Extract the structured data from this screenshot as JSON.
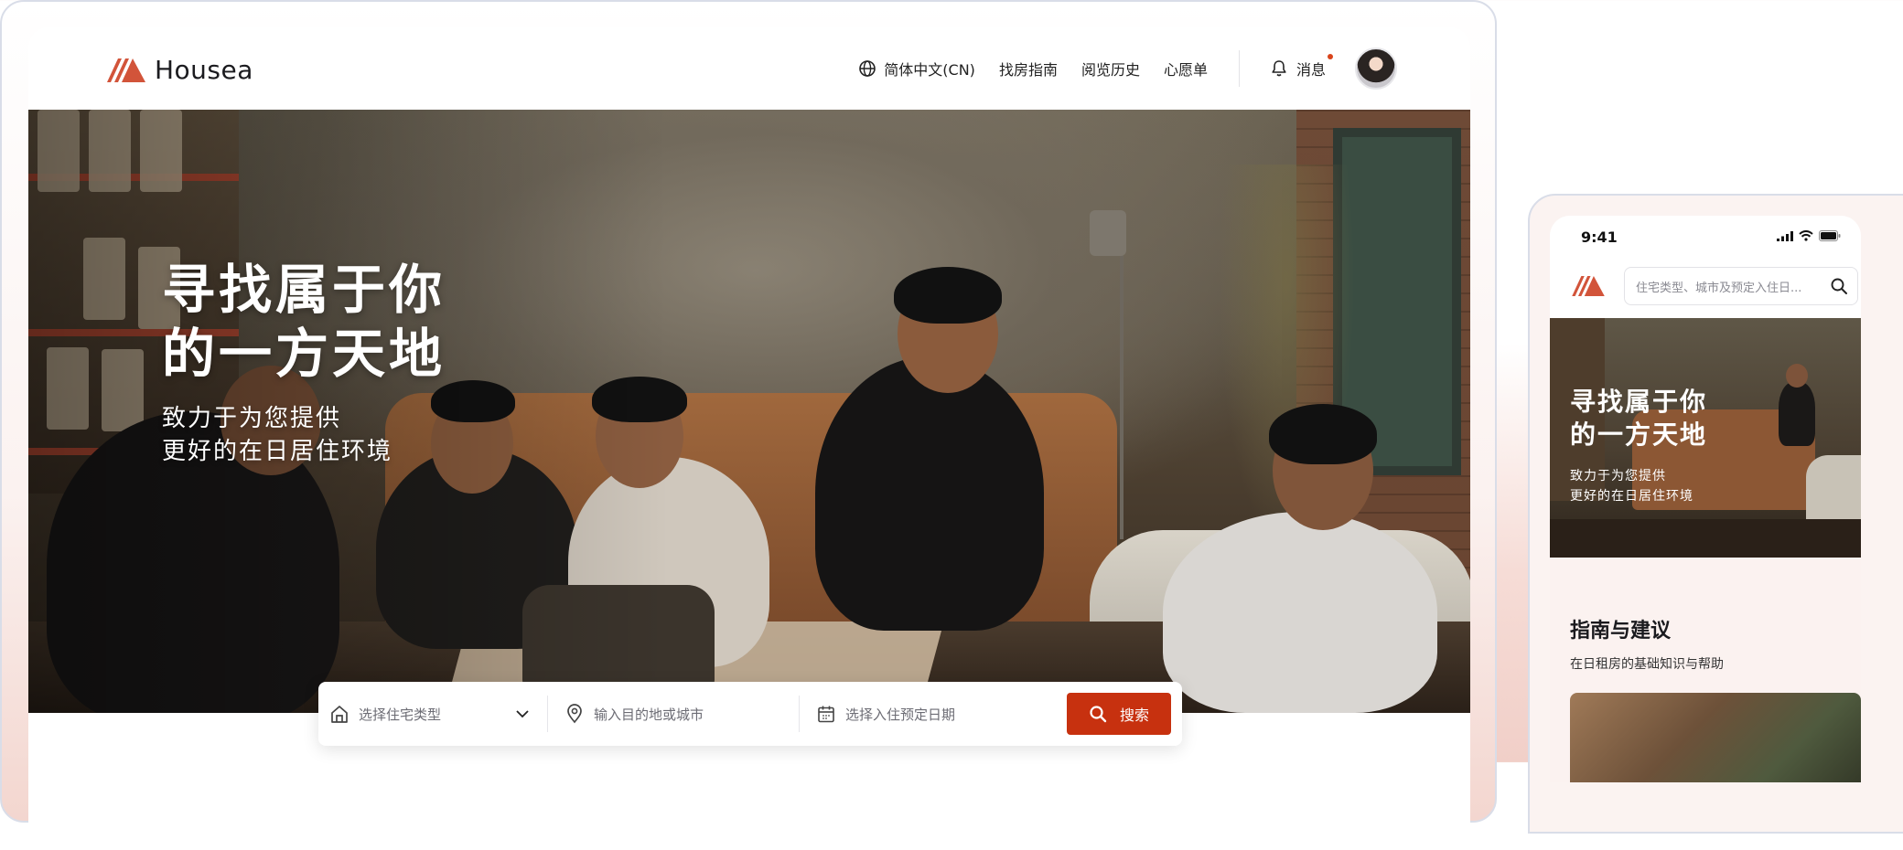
{
  "desktop": {
    "brand": {
      "name": "Housea"
    },
    "nav": {
      "language": "简体中文(CN)",
      "guide": "找房指南",
      "history": "阅览历史",
      "wishlist": "心愿单",
      "messages": "消息"
    },
    "hero": {
      "title_line1": "寻找属于你",
      "title_line2": "的一方天地",
      "subtitle_line1": "致力于为您提供",
      "subtitle_line2": "更好的在日居住环境"
    },
    "search": {
      "type_placeholder": "选择住宅类型",
      "destination_placeholder": "输入目的地或城市",
      "date_placeholder": "选择入住预定日期",
      "button_label": "搜索"
    }
  },
  "mobile": {
    "status_time": "9:41",
    "search_placeholder": "住宅类型、城市及预定入住日...",
    "hero": {
      "title_line1": "寻找属于你",
      "title_line2": "的一方天地",
      "subtitle_line1": "致力于为您提供",
      "subtitle_line2": "更好的在日居住环境"
    },
    "section": {
      "title": "指南与建议",
      "subtitle": "在日租房的基础知识与帮助"
    }
  },
  "colors": {
    "accent": "#c7310f",
    "logo": "#d2543a",
    "notification_dot": "#d9441b"
  },
  "icons": [
    "logo-icon",
    "globe-icon",
    "bell-icon",
    "house-icon",
    "chevron-down-icon",
    "location-pin-icon",
    "calendar-icon",
    "search-icon",
    "signal-icon",
    "wifi-icon",
    "battery-icon"
  ]
}
